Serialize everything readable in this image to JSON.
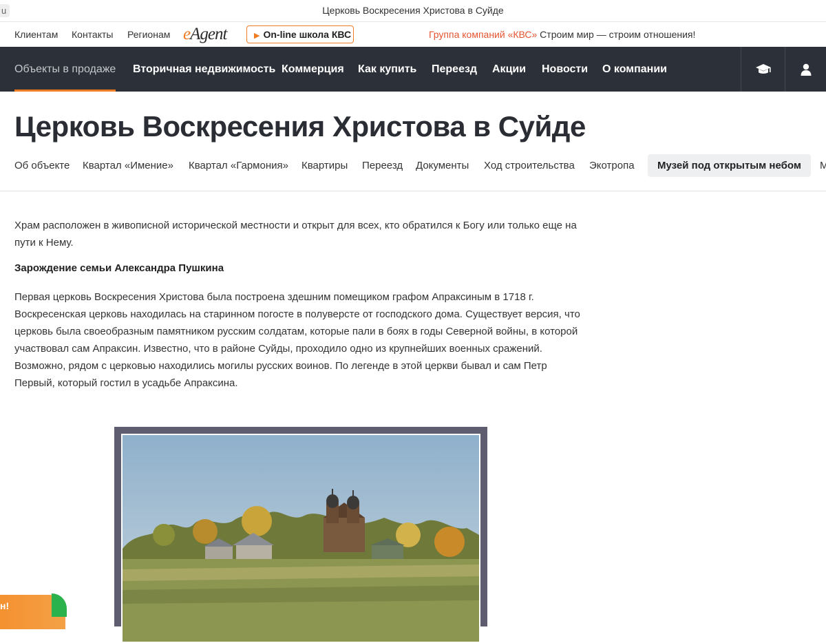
{
  "browser": {
    "url_stub": "u",
    "window_title": "Церковь Воскресения Христова в Суйде"
  },
  "topbar": {
    "links": [
      "Клиентам",
      "Контакты",
      "Регионам"
    ],
    "logo_e": "e",
    "logo_rest": "Agent",
    "school_button": "On-line школа КВС",
    "slogan_accent": "Группа компаний «КВС»",
    "slogan_text": " Строим мир — строим отношения!"
  },
  "nav": {
    "items": [
      {
        "label": "Объекты в продаже",
        "active": true
      },
      {
        "label": "Вторичная недвижимость"
      },
      {
        "label": "Коммерция"
      },
      {
        "label": "Как купить"
      },
      {
        "label": "Переезд"
      },
      {
        "label": "Акции"
      },
      {
        "label": "Новости"
      },
      {
        "label": "О компании"
      }
    ],
    "icons": [
      "graduation-cap-icon",
      "user-icon"
    ]
  },
  "page": {
    "title": "Церковь Воскресения Христова в Суйде"
  },
  "subnav": {
    "items": [
      {
        "label": "Об объекте"
      },
      {
        "label": "Квартал «Имение»"
      },
      {
        "label": "Квартал «Гармония»"
      },
      {
        "label": "Квартиры"
      },
      {
        "label": "Переезд"
      },
      {
        "label": "Документы"
      },
      {
        "label": "Ход строительства"
      },
      {
        "label": "Экотропа"
      },
      {
        "label": "Музей под открытым небом",
        "active": true
      },
      {
        "label": "М"
      }
    ]
  },
  "article": {
    "intro": " Храм расположен в живописной исторической местности и открыт для всех, кто обратился к Богу или только еще на пути к Нему.",
    "subheading": "Зарождение семьи Александра Пушкина",
    "body": "Первая церковь Воскресения Христова была построена здешним помещиком графом Апраксиным в 1718 г. Воскресенская церковь находилась на старинном погосте в полуверсте от господского дома. Существует версия, что церковь была своеобразным памятником русским солдатам, которые пали в боях в годы Северной войны, в которой участвовал сам Апраксин. Известно, что в районе Суйды, проходило одно из крупнейших военных сражений. Возможно, рядом с церковью находились могилы русских воинов. По легенде в этой церкви бывал и сам Петр Первый, который гостил в усадьбе Апраксина."
  },
  "chat": {
    "label": "н!"
  },
  "colors": {
    "accent": "#ef7b22",
    "nav_bg": "#2c3038",
    "slogan_accent": "#e4542f"
  }
}
